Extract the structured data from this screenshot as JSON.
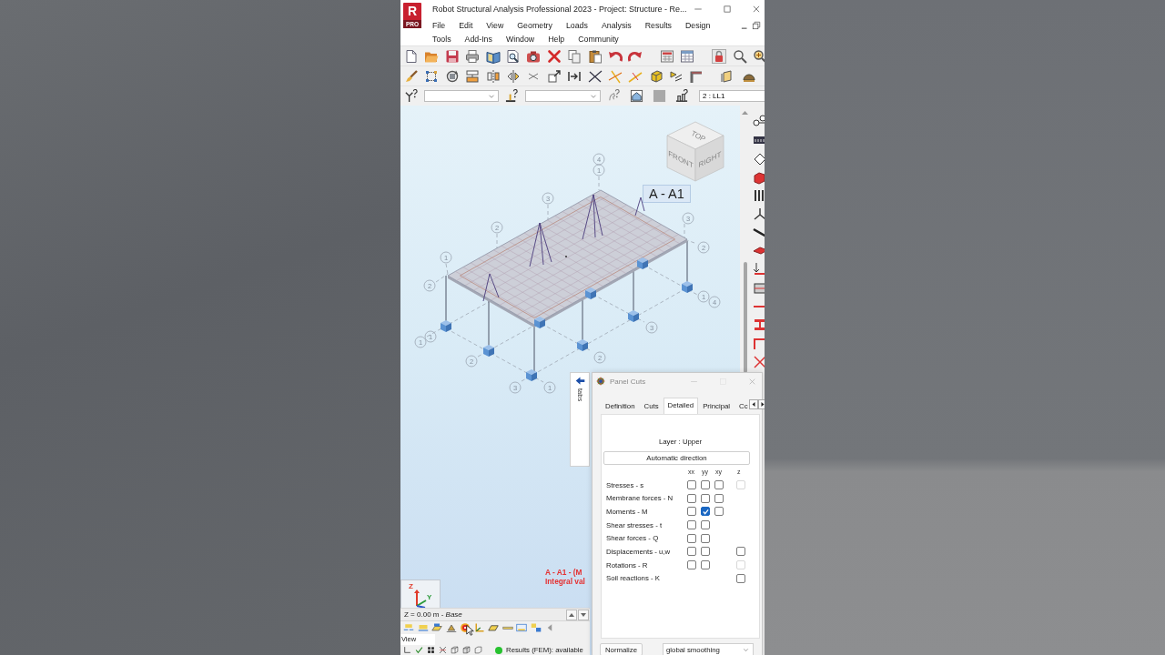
{
  "title_bar": {
    "logo": {
      "letter": "R",
      "badge": "PRO"
    },
    "title": "Robot Structural Analysis Professional 2023 - Project: Structure - Re..."
  },
  "menu_bar": [
    [
      "File",
      "Edit",
      "View",
      "Geometry",
      "Loads",
      "Analysis",
      "Results",
      "Design"
    ],
    [
      "Tools",
      "Add-Ins",
      "Window",
      "Help",
      "Community"
    ]
  ],
  "selection_bar": {
    "load_case": {
      "value": "2 : LL1"
    }
  },
  "view": {
    "view_cube": {
      "faces": [
        "TOP",
        "FRONT",
        "RIGHT"
      ]
    },
    "cut_label": "A - A1",
    "grid_bubbles": [
      "4",
      "1",
      "3",
      "2",
      "1",
      "2",
      "3",
      "2",
      "1",
      "4",
      "1",
      "1",
      "2",
      "3",
      "1",
      "2",
      "3"
    ],
    "result_caption": [
      "A - A1 - (M",
      "Integral val"
    ],
    "axes": [
      "Z",
      "Y"
    ]
  },
  "side_tabs": {
    "label": "tabs"
  },
  "level_bar": {
    "text": "Z = 0.00 m - *Base*"
  },
  "view_field": {
    "value": "View"
  },
  "status_bar": {
    "results": "Results (FEM): available"
  },
  "panel_cuts": {
    "title": "Panel Cuts",
    "tabs": [
      {
        "label": "Definition",
        "selected": false
      },
      {
        "label": "Cuts",
        "selected": false
      },
      {
        "label": "Detailed",
        "selected": true
      },
      {
        "label": "Principal",
        "selected": false
      },
      {
        "label": "Cc",
        "selected": false
      }
    ],
    "layer": "Layer : Upper",
    "direction_button": "Automatic direction",
    "columns": [
      "xx",
      "yy",
      "xy",
      "z"
    ],
    "rows": [
      {
        "label": "Stresses - s",
        "cells": [
          {
            "kind": "checkbox",
            "checked": false,
            "disabled": false
          },
          {
            "kind": "checkbox",
            "checked": false,
            "disabled": false
          },
          {
            "kind": "checkbox",
            "checked": false,
            "disabled": false
          },
          {
            "kind": "checkbox",
            "checked": false,
            "disabled": true
          }
        ]
      },
      {
        "label": "Membrane forces - N",
        "cells": [
          {
            "kind": "checkbox",
            "checked": false,
            "disabled": false
          },
          {
            "kind": "checkbox",
            "checked": false,
            "disabled": false
          },
          {
            "kind": "checkbox",
            "checked": false,
            "disabled": false
          },
          {
            "kind": "blank"
          }
        ]
      },
      {
        "label": "Moments - M",
        "cells": [
          {
            "kind": "checkbox",
            "checked": false,
            "disabled": false
          },
          {
            "kind": "checkbox",
            "checked": true,
            "disabled": false
          },
          {
            "kind": "checkbox",
            "checked": false,
            "disabled": false
          },
          {
            "kind": "blank"
          }
        ]
      },
      {
        "label": "Shear stresses - t",
        "cells": [
          {
            "kind": "checkbox",
            "checked": false,
            "disabled": false
          },
          {
            "kind": "checkbox",
            "checked": false,
            "disabled": false
          },
          {
            "kind": "blank"
          },
          {
            "kind": "blank"
          }
        ]
      },
      {
        "label": "Shear forces - Q",
        "cells": [
          {
            "kind": "checkbox",
            "checked": false,
            "disabled": false
          },
          {
            "kind": "checkbox",
            "checked": false,
            "disabled": false
          },
          {
            "kind": "blank"
          },
          {
            "kind": "blank"
          }
        ]
      },
      {
        "label": "Displacements - u,w",
        "cells": [
          {
            "kind": "checkbox",
            "checked": false,
            "disabled": false
          },
          {
            "kind": "checkbox",
            "checked": false,
            "disabled": false
          },
          {
            "kind": "blank"
          },
          {
            "kind": "checkbox",
            "checked": false,
            "disabled": false
          }
        ]
      },
      {
        "label": "Rotations - R",
        "cells": [
          {
            "kind": "checkbox",
            "checked": false,
            "disabled": false
          },
          {
            "kind": "checkbox",
            "checked": false,
            "disabled": false
          },
          {
            "kind": "blank"
          },
          {
            "kind": "checkbox",
            "checked": false,
            "disabled": true
          }
        ]
      },
      {
        "label": "Soil reactions - K",
        "cells": [
          {
            "kind": "blank"
          },
          {
            "kind": "blank"
          },
          {
            "kind": "blank"
          },
          {
            "kind": "checkbox",
            "checked": false,
            "disabled": false
          }
        ]
      }
    ],
    "normalize_button": "Normalize",
    "smoothing": {
      "value": "global smoothing"
    }
  }
}
